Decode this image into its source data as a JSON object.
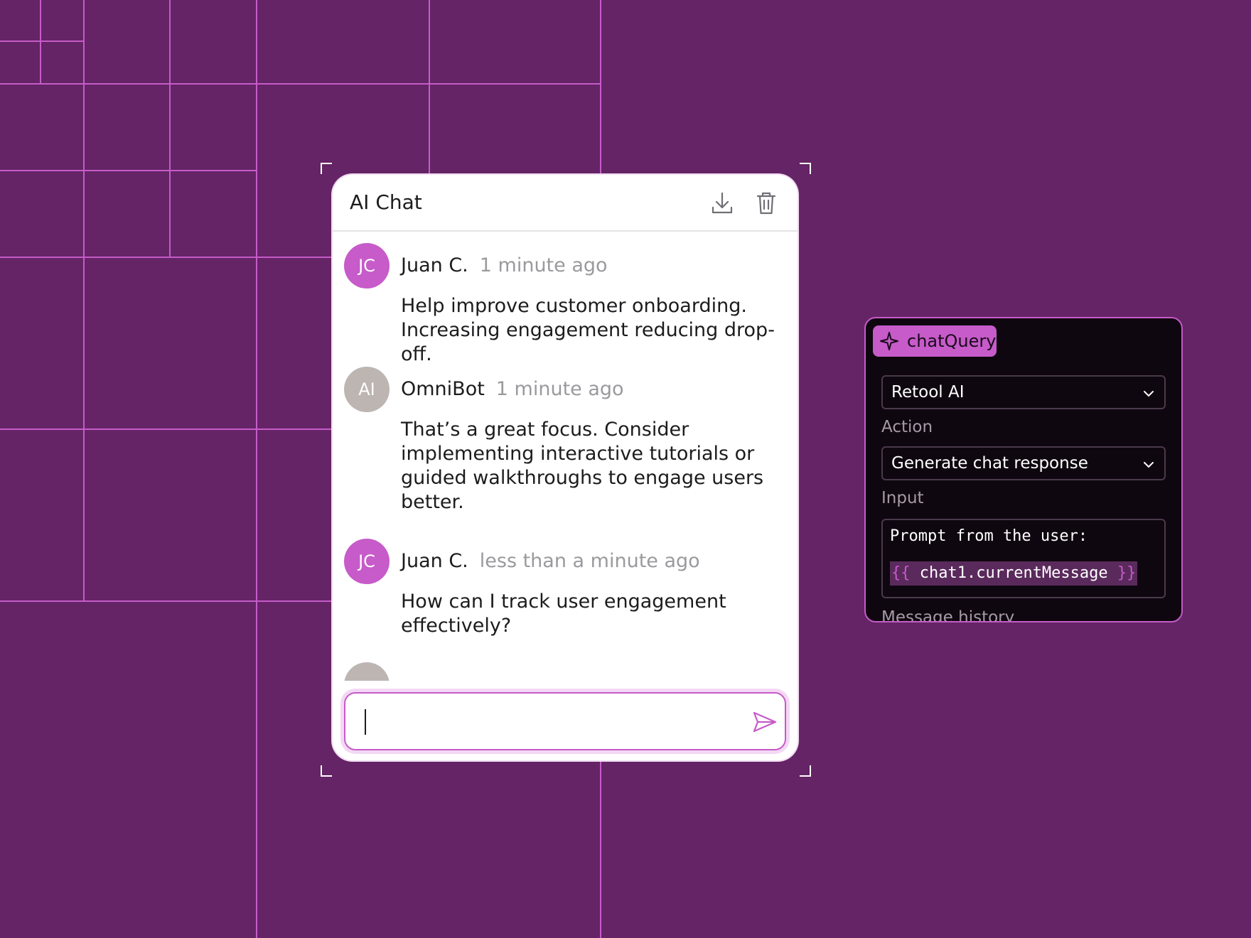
{
  "chat": {
    "title": "AI Chat",
    "download_label": "download-icon",
    "delete_label": "trash-icon",
    "messages": [
      {
        "initials": "JC",
        "sender": "Juan C.",
        "time": "1 minute ago",
        "text": "Help improve customer onboarding. Increasing engagement reducing drop-off."
      },
      {
        "initials": "AI",
        "sender": "OmniBot",
        "time": "1 minute ago",
        "text": "That’s a great focus. Consider implementing interactive tutorials or guided walkthroughs to engage users better."
      },
      {
        "initials": "JC",
        "sender": "Juan C.",
        "time": "less than a minute ago",
        "text": "How can I track user engagement effectively?"
      }
    ],
    "input_value": ""
  },
  "query": {
    "name": "chatQuery",
    "resource": "Retool AI",
    "action_label": "Action",
    "action_value": "Generate chat response",
    "input_label": "Input",
    "input_line1": "Prompt from the user:",
    "input_open": "{{",
    "input_expr": "chat1.currentMessage",
    "input_close": "}}",
    "history_label": "Message history"
  },
  "colors": {
    "background": "#642465",
    "accent": "#c65bc9",
    "panel": "#0f0710",
    "bot_avatar": "#bdb5b2"
  }
}
